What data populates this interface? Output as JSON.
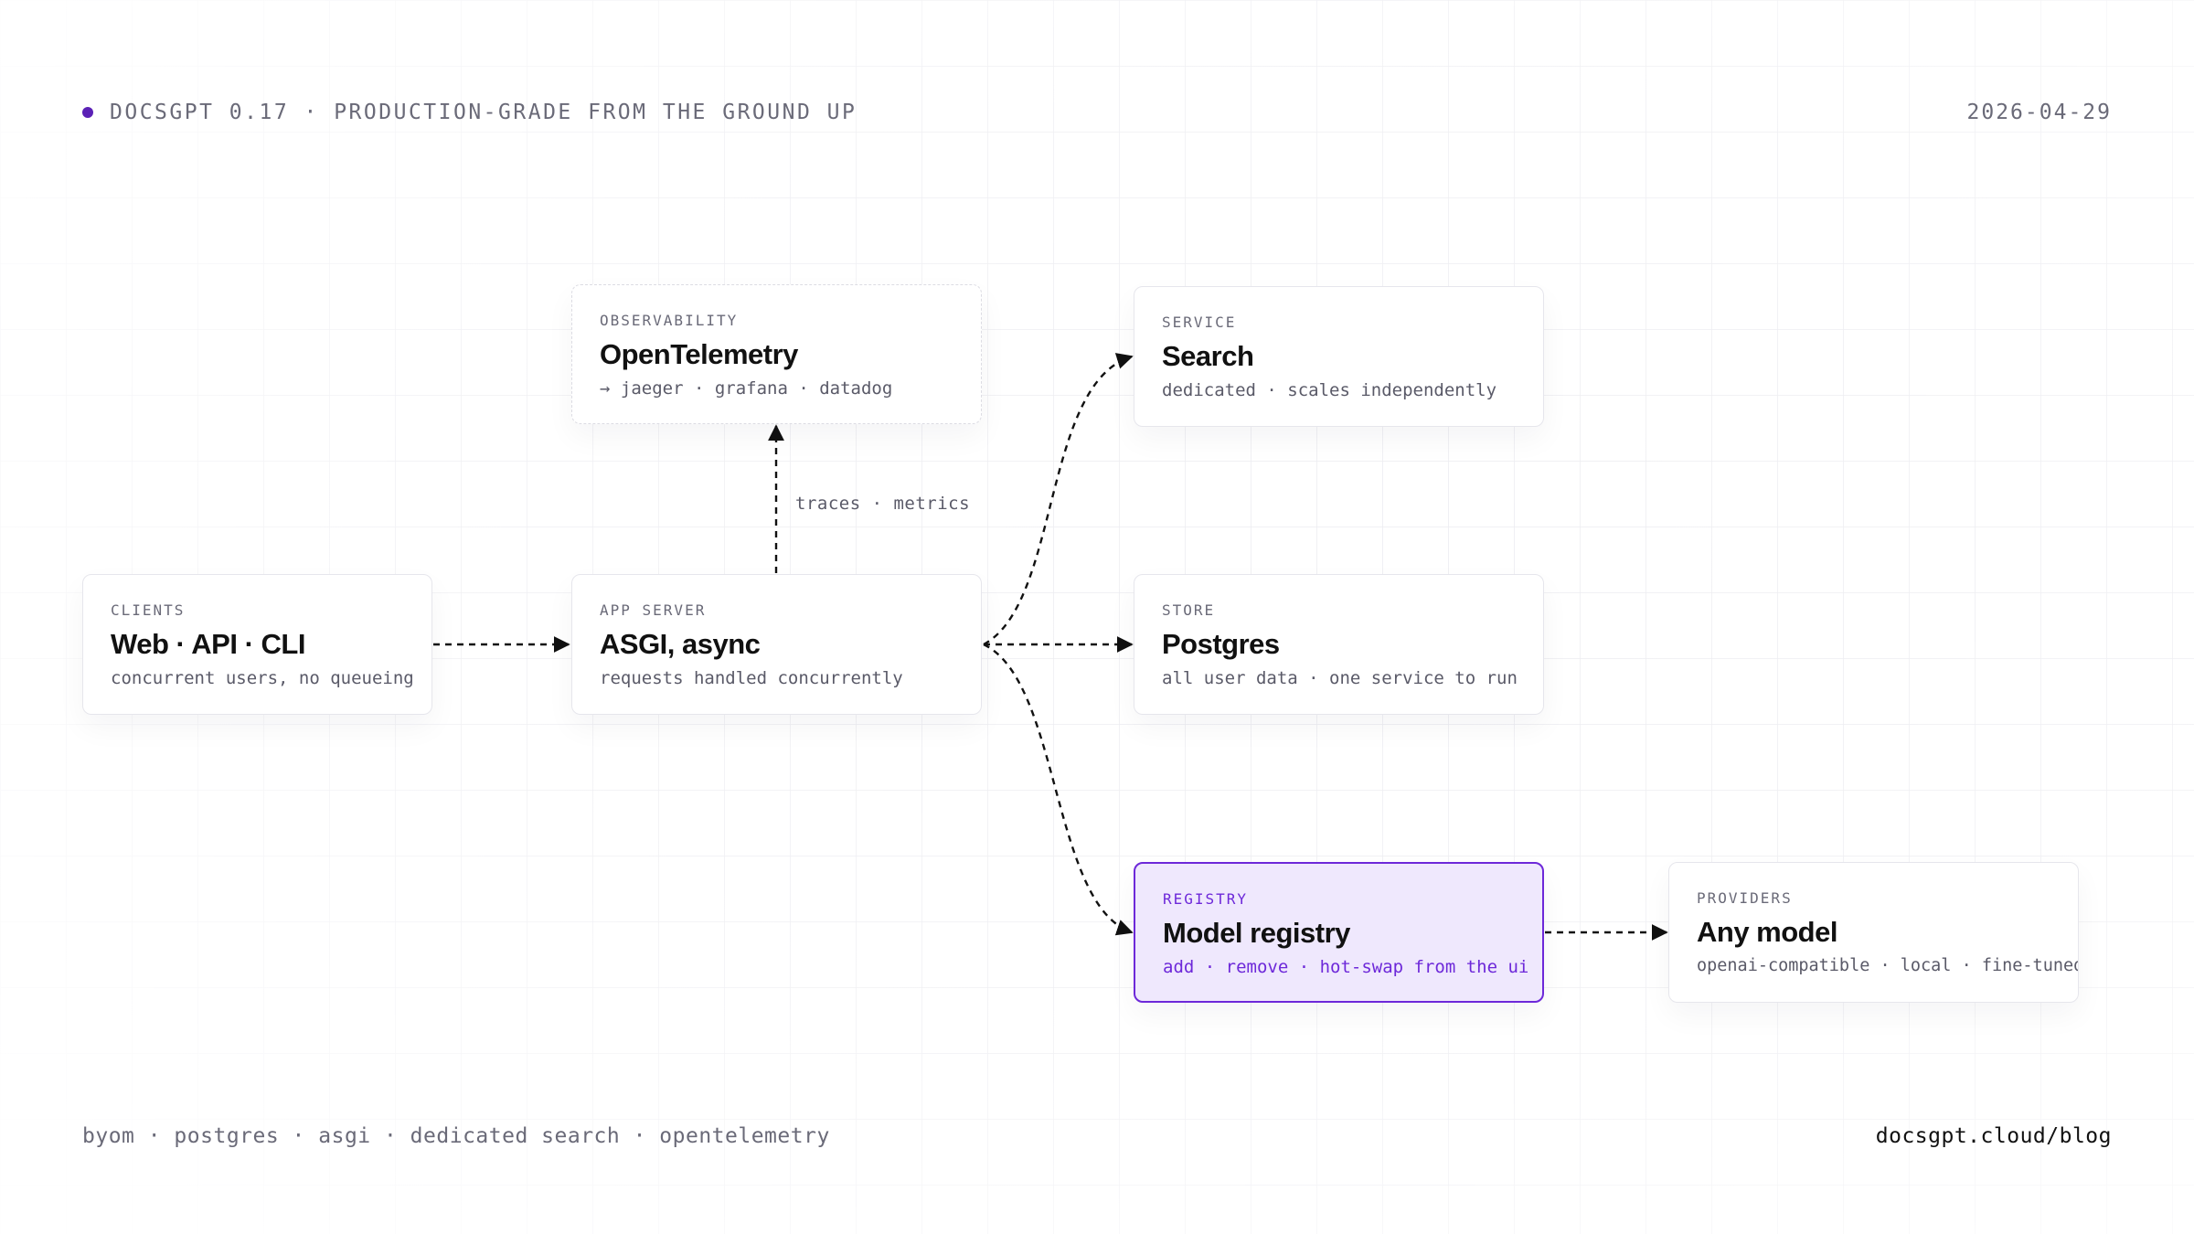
{
  "header": {
    "title": "DOCSGPT 0.17 · PRODUCTION-GRADE FROM THE GROUND UP",
    "date": "2026-04-29"
  },
  "nodes": {
    "observability": {
      "tag": "OBSERVABILITY",
      "title": "OpenTelemetry",
      "subtitle": "→ jaeger · grafana · datadog"
    },
    "search": {
      "tag": "SERVICE",
      "title": "Search",
      "subtitle": "dedicated · scales independently"
    },
    "clients": {
      "tag": "CLIENTS",
      "title": "Web · API · CLI",
      "subtitle": "concurrent users, no queueing"
    },
    "app_server": {
      "tag": "APP SERVER",
      "title": "ASGI, async",
      "subtitle": "requests handled concurrently"
    },
    "store": {
      "tag": "STORE",
      "title": "Postgres",
      "subtitle": "all user data · one service to run"
    },
    "registry": {
      "tag": "REGISTRY",
      "title": "Model registry",
      "subtitle": "add · remove · hot-swap from the ui"
    },
    "providers": {
      "tag": "PROVIDERS",
      "title": "Any model",
      "subtitle": "openai-compatible · local · fine-tuned"
    }
  },
  "edges": {
    "traces_label": "traces · metrics"
  },
  "footer": {
    "tags": "byom · postgres · asgi · dedicated search · opentelemetry",
    "link": "docsgpt.cloud/blog"
  },
  "colors": {
    "accent": "#6d28d9",
    "accent_fill": "#efe8fd",
    "dot": "#5b21b6",
    "muted_text": "#6a6a78",
    "grid": "#ececf1"
  }
}
